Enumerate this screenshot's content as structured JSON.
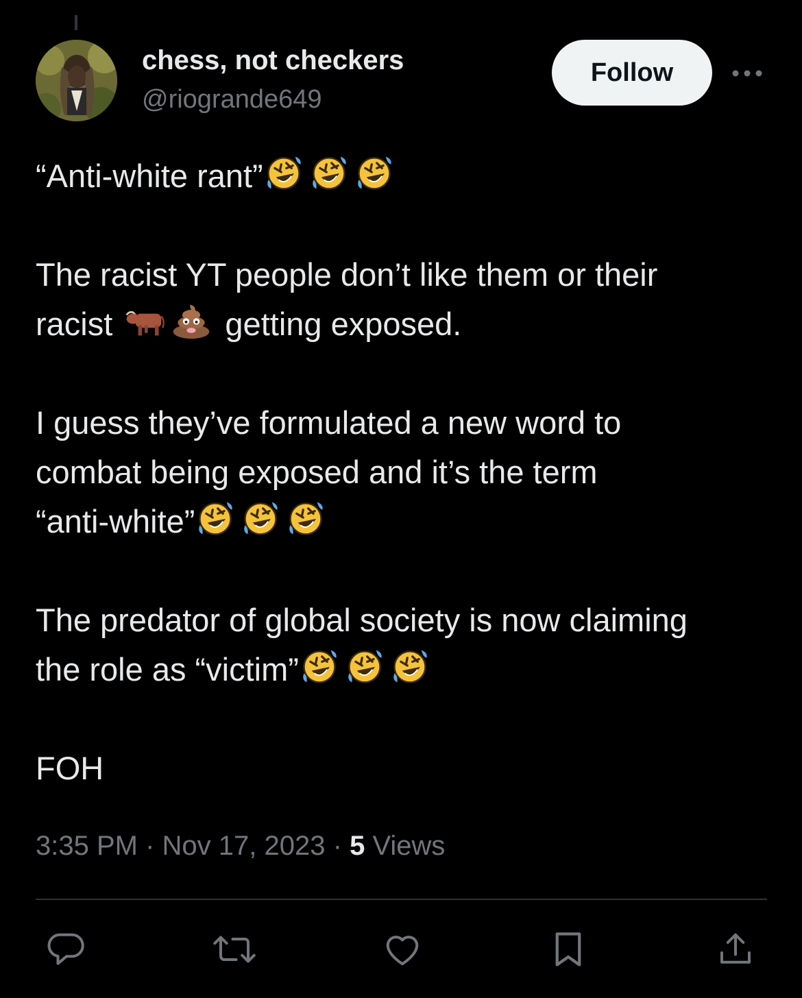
{
  "author": {
    "display_name": "chess, not checkers",
    "handle": "@riogrande649"
  },
  "follow_label": "Follow",
  "tweet": {
    "p1": "“Anti-white rant”",
    "p2_line1": "The racist YT people don’t like them or their",
    "p2_line2_start": "racist",
    "p2_line2_end": "getting exposed.",
    "p3_line1": "I guess they’ve formulated a new word to",
    "p3_line2": "combat being exposed and it’s the term",
    "p3_line3": "“anti-white”",
    "p4_line1": "The predator of global society is now claiming",
    "p4_line2": "the role as “victim”",
    "p5": "FOH",
    "emojis": [
      "rolling-on-floor-laughing-emoji",
      "ox-emoji",
      "pile-of-poo-emoji"
    ]
  },
  "meta": {
    "time": "3:35 PM",
    "separator": "·",
    "date": "Nov 17, 2023",
    "views_count": "5",
    "views_label": "Views"
  },
  "actions": [
    "reply-icon",
    "retweet-icon",
    "like-icon",
    "bookmark-icon",
    "share-icon"
  ],
  "colors": {
    "background": "#000000",
    "text": "#e7e9ea",
    "secondary": "#71767b",
    "follow_bg": "#eff3f4",
    "divider": "#2f3336"
  }
}
